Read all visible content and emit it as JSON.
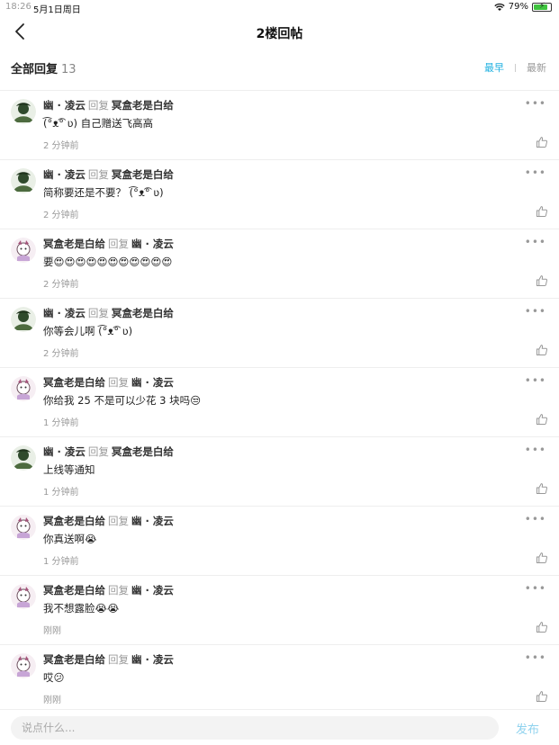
{
  "status": {
    "time": "18:26",
    "date": "5月1日周日",
    "battery": "79%"
  },
  "nav": {
    "title": "2楼回帖"
  },
  "header": {
    "label": "全部回复",
    "count": "13",
    "sort_earliest": "最早",
    "sort_latest": "最新"
  },
  "reply_word": "回复",
  "replies": [
    {
      "from": "幽 · 凌云",
      "to": "冥盒老是白给",
      "text": "(͡°ᴥ͡° ʋ) 自己赠送飞高高",
      "time": "2 分钟前",
      "avatar": "green"
    },
    {
      "from": "幽 · 凌云",
      "to": "冥盒老是白给",
      "text": "简称要还是不要？ (͡°ᴥ͡° ʋ)",
      "time": "2 分钟前",
      "avatar": "green"
    },
    {
      "from": "冥盒老是白给",
      "to": "幽 · 凌云",
      "text": "要😍😍😍😍😍😍😍😍😍😍😍",
      "time": "2 分钟前",
      "avatar": "cartoon"
    },
    {
      "from": "幽 · 凌云",
      "to": "冥盒老是白给",
      "text": "你等会儿啊 (͡°ᴥ͡° ʋ)",
      "time": "2 分钟前",
      "avatar": "green"
    },
    {
      "from": "冥盒老是白给",
      "to": "幽 · 凌云",
      "text": "你给我 25 不是可以少花 3 块吗😒",
      "time": "1 分钟前",
      "avatar": "cartoon"
    },
    {
      "from": "幽 · 凌云",
      "to": "冥盒老是白给",
      "text": "上线等通知",
      "time": "1 分钟前",
      "avatar": "green"
    },
    {
      "from": "冥盒老是白给",
      "to": "幽 · 凌云",
      "text": "你真送啊😭",
      "time": "1 分钟前",
      "avatar": "cartoon"
    },
    {
      "from": "冥盒老是白给",
      "to": "幽 · 凌云",
      "text": "我不想露脸😭😭",
      "time": "刚刚",
      "avatar": "cartoon"
    },
    {
      "from": "冥盒老是白给",
      "to": "幽 · 凌云",
      "text": "哎😕",
      "time": "刚刚",
      "avatar": "cartoon"
    }
  ],
  "composer": {
    "placeholder": "说点什么...",
    "publish_label": "发布"
  },
  "colors": {
    "accent": "#1fb0e0",
    "publish": "#8fd2ee"
  }
}
